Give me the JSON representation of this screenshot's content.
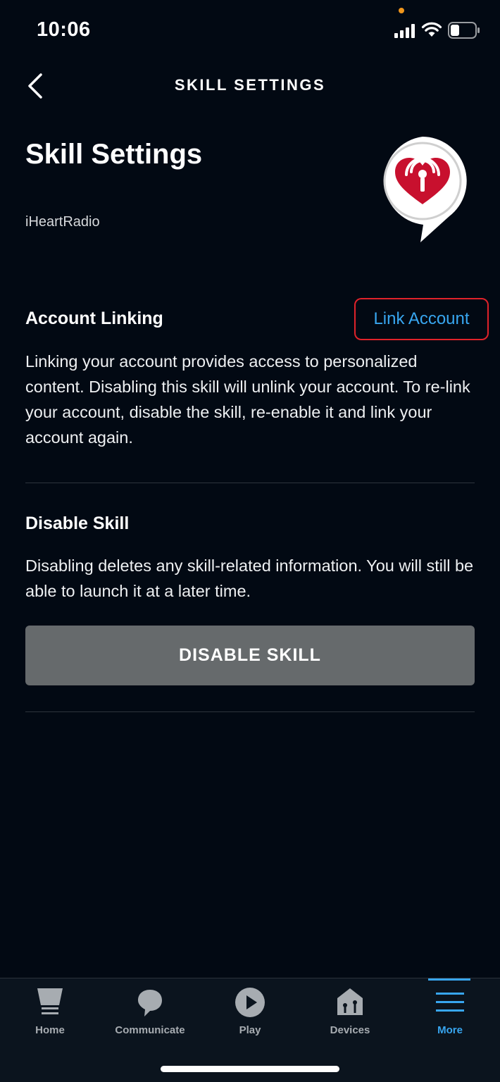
{
  "status_bar": {
    "time": "10:06",
    "icons": [
      "signal-icon",
      "wifi-icon",
      "battery-icon"
    ]
  },
  "nav": {
    "title": "SKILL SETTINGS",
    "back_icon": "chevron-left-icon"
  },
  "page": {
    "title": "Skill Settings",
    "skill_name": "iHeartRadio",
    "logo_icon": "iheartradio-logo-icon"
  },
  "account_linking": {
    "heading": "Account Linking",
    "link_label": "Link Account",
    "description": "Linking your account provides access to personalized content. Disabling this skill will unlink your account. To re-link your account, disable the skill, re-enable it and link your account again."
  },
  "disable_skill": {
    "heading": "Disable Skill",
    "description": "Disabling deletes any skill-related information. You will still be able to launch it at a later time.",
    "button_label": "DISABLE SKILL"
  },
  "tab_bar": {
    "tabs": [
      {
        "label": "Home",
        "icon": "home-icon"
      },
      {
        "label": "Communicate",
        "icon": "chat-bubble-icon"
      },
      {
        "label": "Play",
        "icon": "play-icon"
      },
      {
        "label": "Devices",
        "icon": "devices-icon"
      },
      {
        "label": "More",
        "icon": "menu-icon"
      }
    ],
    "active": "More"
  },
  "colors": {
    "background": "#020913",
    "accent": "#38a6f0",
    "highlight_border": "#e0222a",
    "button": "#666a6c",
    "brand_red": "#c8102e"
  }
}
